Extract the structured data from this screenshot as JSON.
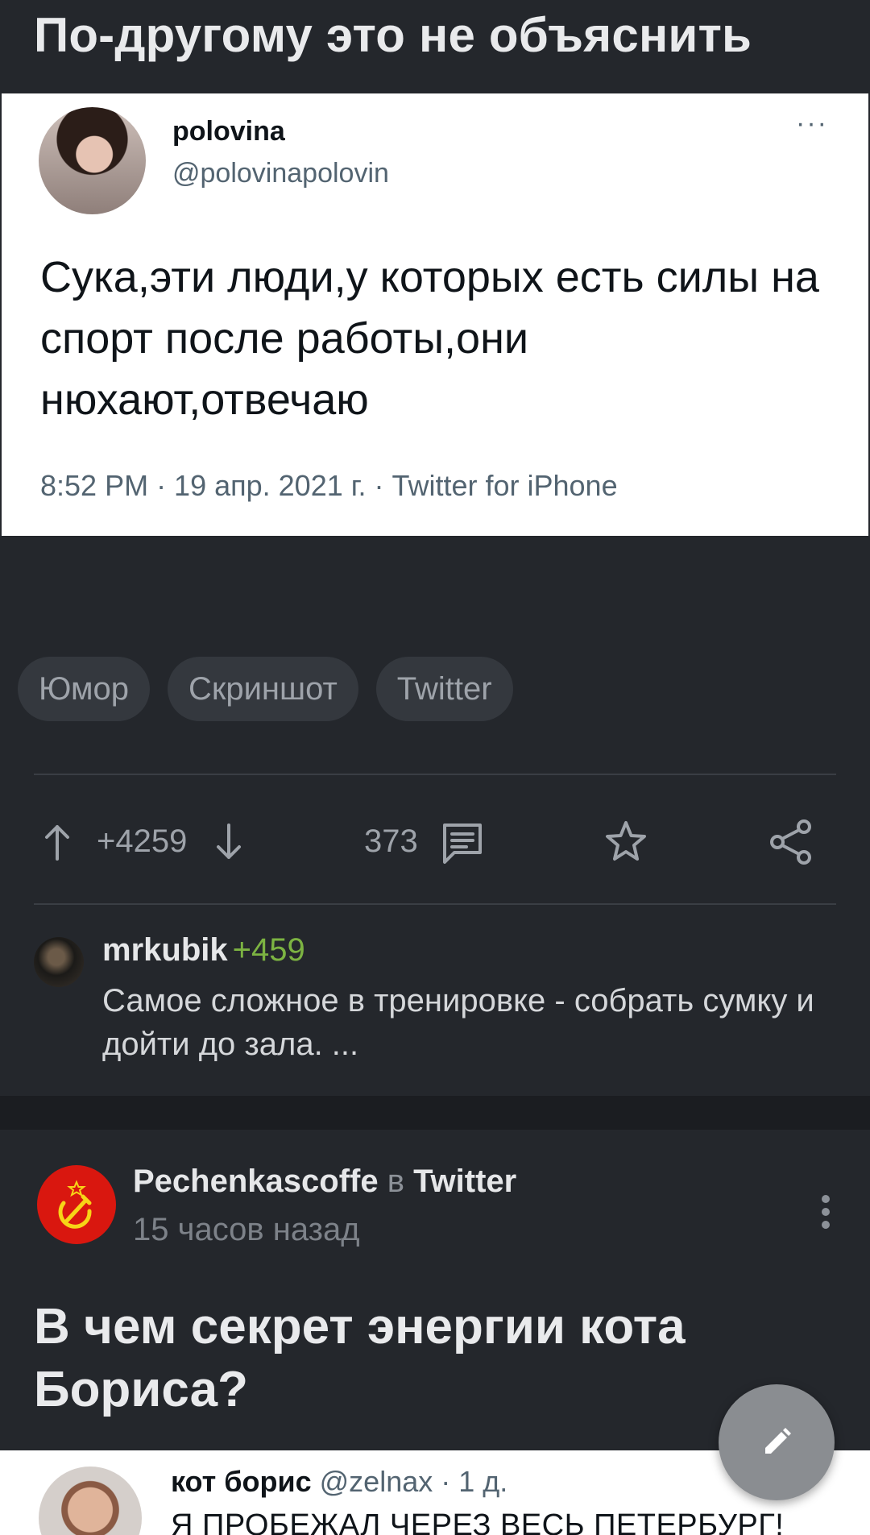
{
  "post": {
    "title": "По-другому это не объяснить",
    "tweet": {
      "name": "polovina",
      "handle": "@polovinapolovin",
      "more": "···",
      "text": "Сука,эти люди,у которых есть силы на спорт после работы,они нюхают,отвечаю",
      "meta": "8:52 PM · 19 апр. 2021 г. · Twitter for iPhone"
    },
    "tags": [
      "Юмор",
      "Скриншот",
      "Twitter"
    ],
    "actions": {
      "rating": "+4259",
      "comments_count": "373"
    },
    "top_comment": {
      "user": "mrkubik",
      "rating": "+459",
      "text": "Самое сложное в тренировке - собрать сумку и дойти до зала. ..."
    }
  },
  "next_post": {
    "author": "Pechenkascoffe",
    "in_word": "в",
    "community": "Twitter",
    "time": "15 часов назад",
    "title": "В чем секрет энергии кота Бориса?",
    "tweet_preview": {
      "name": "кот борис",
      "handle": "@zelnax · 1 д.",
      "text": "Я ПРОБЕЖАЛ ЧЕРЕЗ ВЕСЬ ПЕТЕРБУРГ!"
    }
  },
  "colors": {
    "background": "#24272c",
    "rating_green": "#7cb342",
    "tag_bg": "#34383e",
    "avatar_red": "#d9170f"
  },
  "icons": [
    "arrow-up-icon",
    "arrow-down-icon",
    "comment-icon",
    "star-icon",
    "share-icon",
    "more-vertical-icon",
    "hammer-sickle-icon",
    "pencil-icon"
  ]
}
